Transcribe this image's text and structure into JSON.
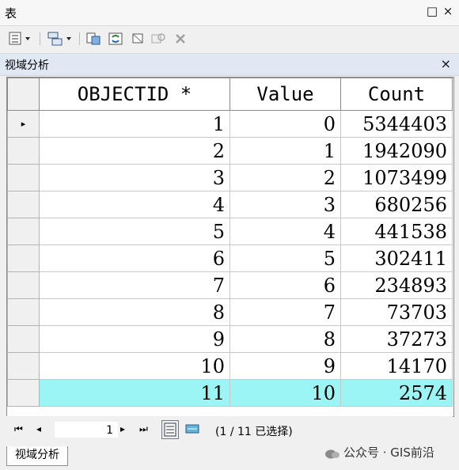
{
  "window": {
    "title": "表",
    "restore_glyph": "□",
    "close_glyph": "×"
  },
  "toolbar": {
    "items": [
      "table-options-icon",
      "related-tables-icon",
      "select-by-attributes-icon",
      "switch-selection-icon",
      "clear-selection-icon",
      "zoom-to-selected-icon",
      "delete-selected-icon"
    ]
  },
  "tab": {
    "name": "视域分析",
    "close_glyph": "×"
  },
  "table": {
    "columns": [
      "",
      "OBJECTID *",
      "Value",
      "Count"
    ],
    "rows": [
      {
        "objectid": "1",
        "value": "0",
        "count": "5344403",
        "current": true
      },
      {
        "objectid": "2",
        "value": "1",
        "count": "1942090"
      },
      {
        "objectid": "3",
        "value": "2",
        "count": "1073499"
      },
      {
        "objectid": "4",
        "value": "3",
        "count": "680256"
      },
      {
        "objectid": "5",
        "value": "4",
        "count": "441538"
      },
      {
        "objectid": "6",
        "value": "5",
        "count": "302411"
      },
      {
        "objectid": "7",
        "value": "6",
        "count": "234893"
      },
      {
        "objectid": "8",
        "value": "7",
        "count": "73703"
      },
      {
        "objectid": "9",
        "value": "8",
        "count": "37273"
      },
      {
        "objectid": "10",
        "value": "9",
        "count": "14170"
      },
      {
        "objectid": "11",
        "value": "10",
        "count": "2574",
        "highlight": true
      }
    ],
    "current_row_marker": "▸",
    "highlight_color": "#9cf5f5"
  },
  "navigation": {
    "first": "⏮",
    "prev": "◂",
    "record": "1",
    "next": "▸",
    "last": "⏭",
    "selection_text": "(1 / 11 已选择)"
  },
  "bottom_tab": {
    "label": "视域分析"
  },
  "watermark": {
    "text": "公众号 · GIS前沿"
  }
}
